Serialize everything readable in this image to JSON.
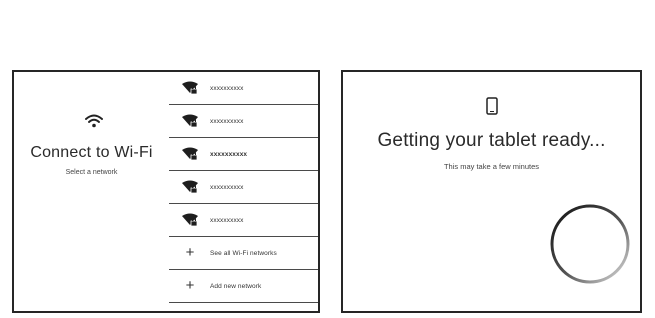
{
  "wifi_screen": {
    "title": "Connect to Wi-Fi",
    "subtitle": "Select a network",
    "networks": [
      {
        "name": "xxxxxxxxxx",
        "selected": false,
        "icon": "wifi-locked-icon"
      },
      {
        "name": "xxxxxxxxxx",
        "selected": false,
        "icon": "wifi-locked-icon"
      },
      {
        "name": "xxxxxxxxxx",
        "selected": true,
        "icon": "wifi-locked-icon"
      },
      {
        "name": "xxxxxxxxxx",
        "selected": false,
        "icon": "wifi-locked-icon"
      },
      {
        "name": "xxxxxxxxxx",
        "selected": false,
        "icon": "wifi-locked-icon"
      }
    ],
    "actions": [
      {
        "label": "See all Wi-Fi networks",
        "icon": "plus-icon"
      },
      {
        "label": "Add new network",
        "icon": "plus-icon"
      }
    ]
  },
  "setup_screen": {
    "title": "Getting your tablet ready...",
    "subtitle": "This may take a few minutes",
    "icon": "tablet-icon",
    "spinner_icon": "loading-spinner-icon"
  },
  "colors": {
    "text": "#2a2a2a",
    "border": "#262626",
    "background": "#ffffff"
  }
}
